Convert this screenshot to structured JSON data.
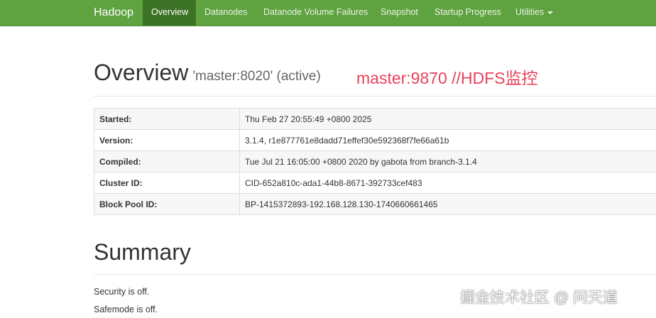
{
  "navbar": {
    "brand": "Hadoop",
    "items": [
      {
        "label": "Overview"
      },
      {
        "label": "Datanodes"
      },
      {
        "label": "Datanode Volume Failures"
      },
      {
        "label": "Snapshot"
      },
      {
        "label": "Startup Progress"
      },
      {
        "label": "Utilities"
      }
    ]
  },
  "overview": {
    "title": "Overview",
    "subtitle": "'master:8020' (active)",
    "annotation": "master:9870 //HDFS监控"
  },
  "info": {
    "rows": [
      {
        "key": "Started:",
        "value": "Thu Feb 27 20:55:49 +0800 2025"
      },
      {
        "key": "Version:",
        "value": "3.1.4, r1e877761e8dadd71effef30e592368f7fe66a61b"
      },
      {
        "key": "Compiled:",
        "value": "Tue Jul 21 16:05:00 +0800 2020 by gabota from branch-3.1.4"
      },
      {
        "key": "Cluster ID:",
        "value": "CID-652a810c-ada1-44b8-8671-392733cef483"
      },
      {
        "key": "Block Pool ID:",
        "value": "BP-1415372893-192.168.128.130-1740660661465"
      }
    ]
  },
  "summary": {
    "title": "Summary",
    "security": "Security is off.",
    "safemode": "Safemode is off."
  },
  "watermark": "掘金技术社区 @ 问天道",
  "colors": {
    "navbar": "#5fa341",
    "navbar_active": "#3c7226",
    "annotation": "#e8415a"
  },
  "icons": {
    "utilities_dropdown": "caret-down-icon"
  }
}
